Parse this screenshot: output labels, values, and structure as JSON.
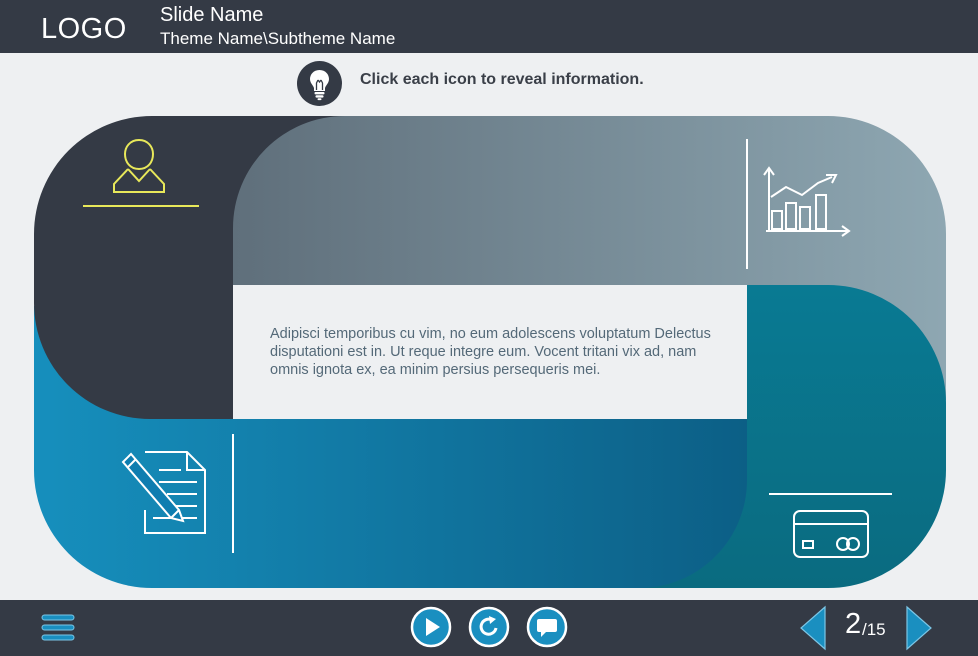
{
  "header": {
    "logo": "LOGO",
    "slide_name": "Slide Name",
    "theme_name": "Theme Name\\Subtheme Name"
  },
  "instruction": {
    "icon": "lightbulb-icon",
    "text": "Click each icon to reveal information."
  },
  "content": {
    "body": "Adipisci temporibus cu vim, no eum adolescens voluptatum Delectus disputationi est in. Ut reque integre eum. Vocent tritani vix ad, nam omnis ignota ex, ea minim persius persequeris mei."
  },
  "hotspots": [
    {
      "icon": "user-icon",
      "color": "#e8e85a"
    },
    {
      "icon": "chart-growth-icon",
      "color": "#ffffff"
    },
    {
      "icon": "document-pencil-icon",
      "color": "#ffffff"
    },
    {
      "icon": "credit-card-icon",
      "color": "#ffffff"
    }
  ],
  "footer": {
    "menu_icon": "menu-icon",
    "play_icon": "play-icon",
    "replay_icon": "replay-icon",
    "comment_icon": "comment-icon",
    "prev_icon": "prev-arrow-icon",
    "next_icon": "next-arrow-icon",
    "page_current": "2",
    "page_total": "/15"
  },
  "colors": {
    "dark": "#343a45",
    "accent_blue": "#1a8fc0",
    "teal": "#0d7e94",
    "slate": "#7f97a2",
    "background": "#eef0f2"
  }
}
